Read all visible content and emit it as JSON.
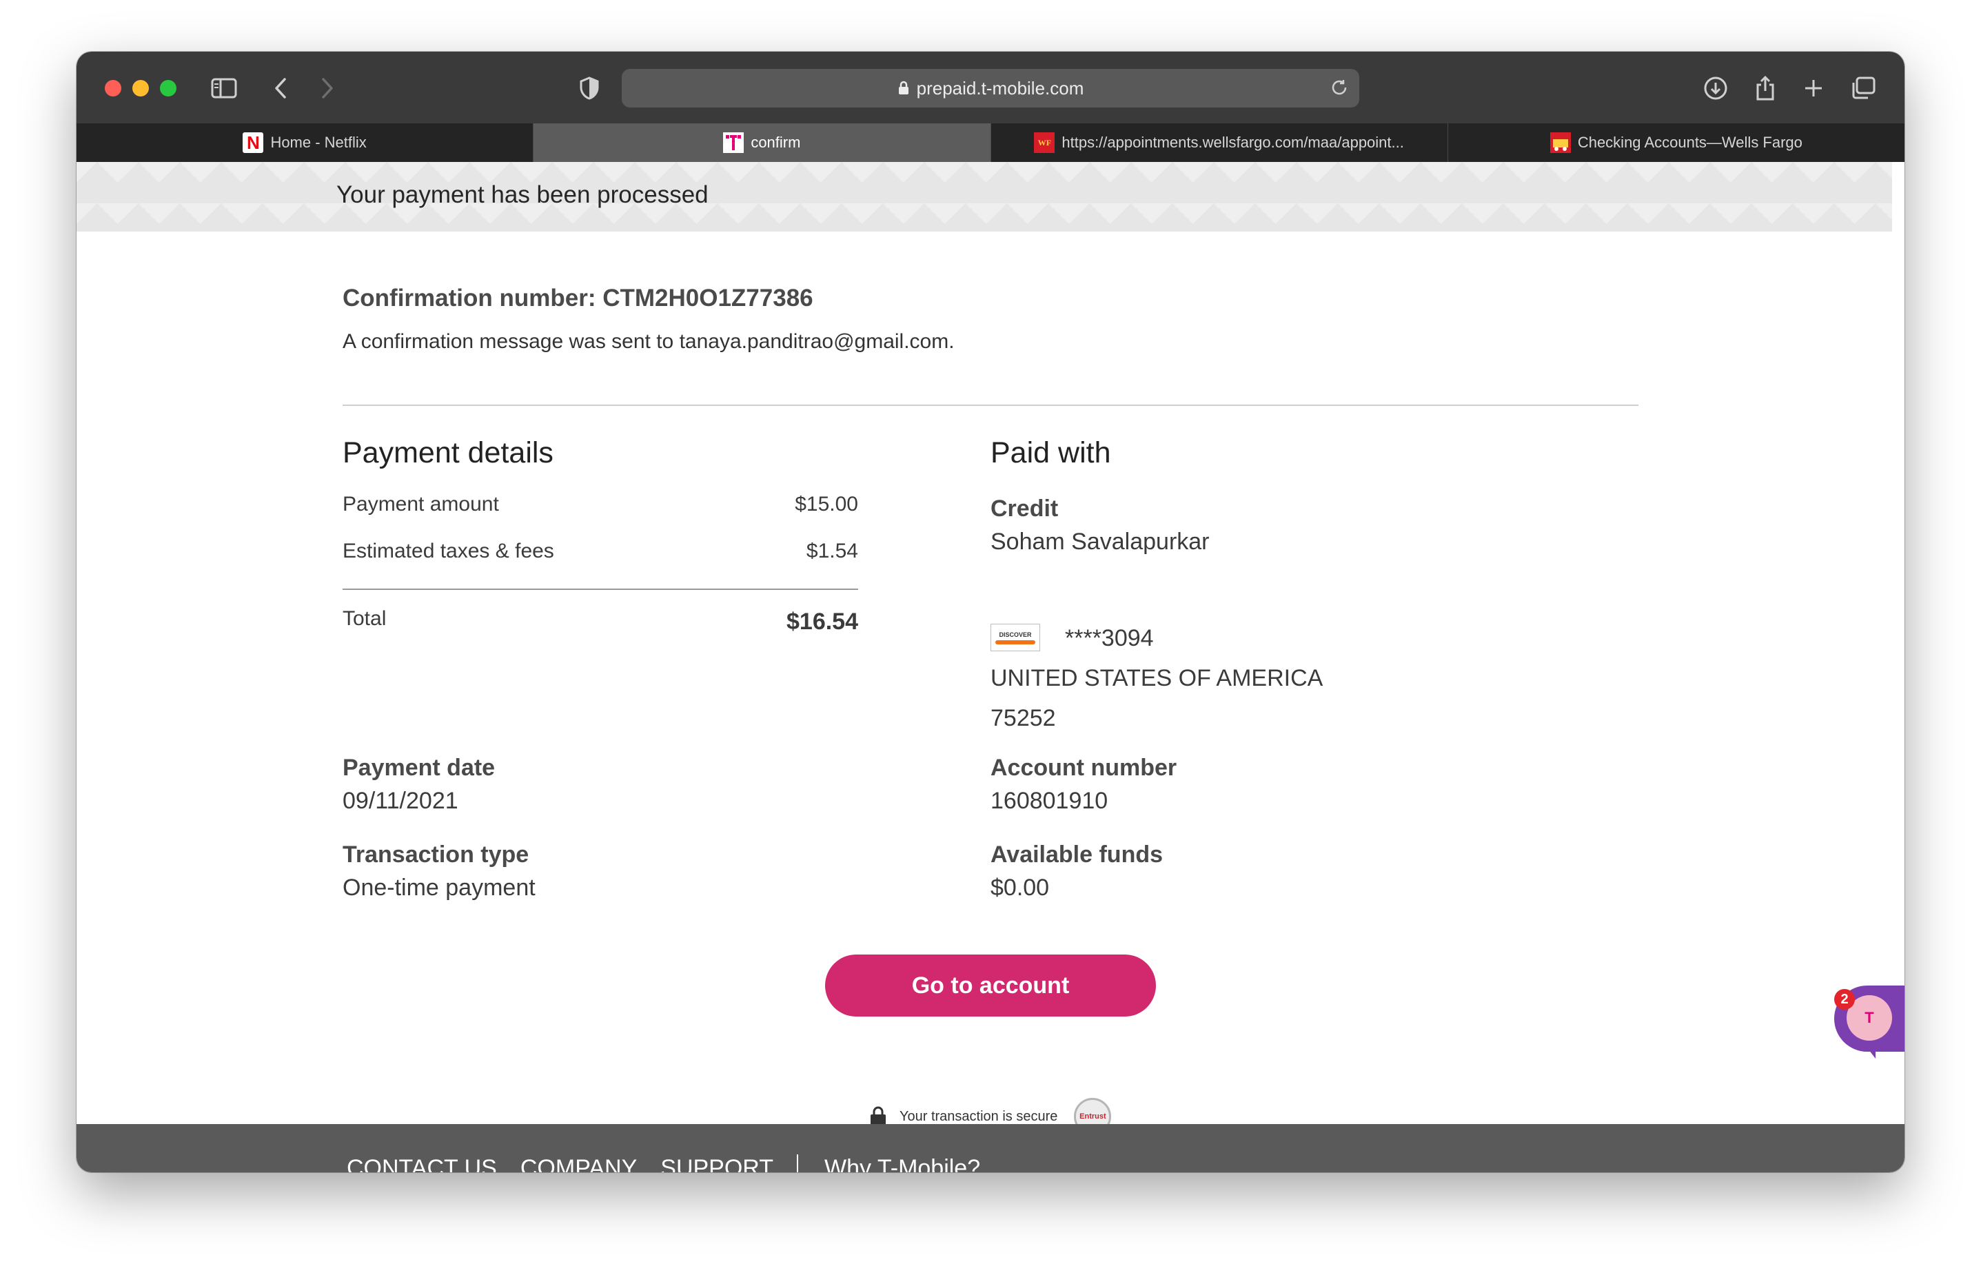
{
  "browser": {
    "url": "prepaid.t-mobile.com",
    "tabs": [
      {
        "label": "Home - Netflix",
        "active": false
      },
      {
        "label": "confirm",
        "active": true
      },
      {
        "label": "https://appointments.wellsfargo.com/maa/appoint...",
        "active": false
      },
      {
        "label": "Checking Accounts—Wells Fargo",
        "active": false
      }
    ],
    "favicons": {
      "netflix": "N",
      "wellsfargo": "WF"
    }
  },
  "banner": {
    "text": "Your payment has been processed"
  },
  "confirmation": {
    "number_text": "Confirmation number: CTM2H0O1Z77386",
    "message": "A confirmation message was sent to tanaya.panditrao@gmail.com."
  },
  "payment_details": {
    "heading": "Payment details",
    "rows": [
      {
        "label": "Payment amount",
        "value": "$15.00"
      },
      {
        "label": "Estimated taxes & fees",
        "value": "$1.54"
      }
    ],
    "total_label": "Total",
    "total_value": "$16.54",
    "payment_date_label": "Payment date",
    "payment_date": "09/11/2021",
    "transaction_type_label": "Transaction type",
    "transaction_type": "One-time payment"
  },
  "paid_with": {
    "heading": "Paid with",
    "method": "Credit",
    "name": "Soham Savalapurkar",
    "card_brand": "DISCOVER",
    "card_masked": "****3094",
    "country": "UNITED STATES OF AMERICA",
    "zip": "75252",
    "account_number_label": "Account number",
    "account_number": "160801910",
    "available_funds_label": "Available funds",
    "available_funds": "$0.00"
  },
  "actions": {
    "go_to_account": "Go to account"
  },
  "secure": {
    "text": "Your transaction is secure",
    "seal": "Entrust"
  },
  "chat": {
    "badge": "2"
  },
  "footer": {
    "links": [
      "CONTACT US",
      "COMPANY",
      "SUPPORT"
    ],
    "extra": "Why T-Mobile?"
  },
  "colors": {
    "accent": "#d1286e",
    "chat": "#7c3fb0"
  }
}
